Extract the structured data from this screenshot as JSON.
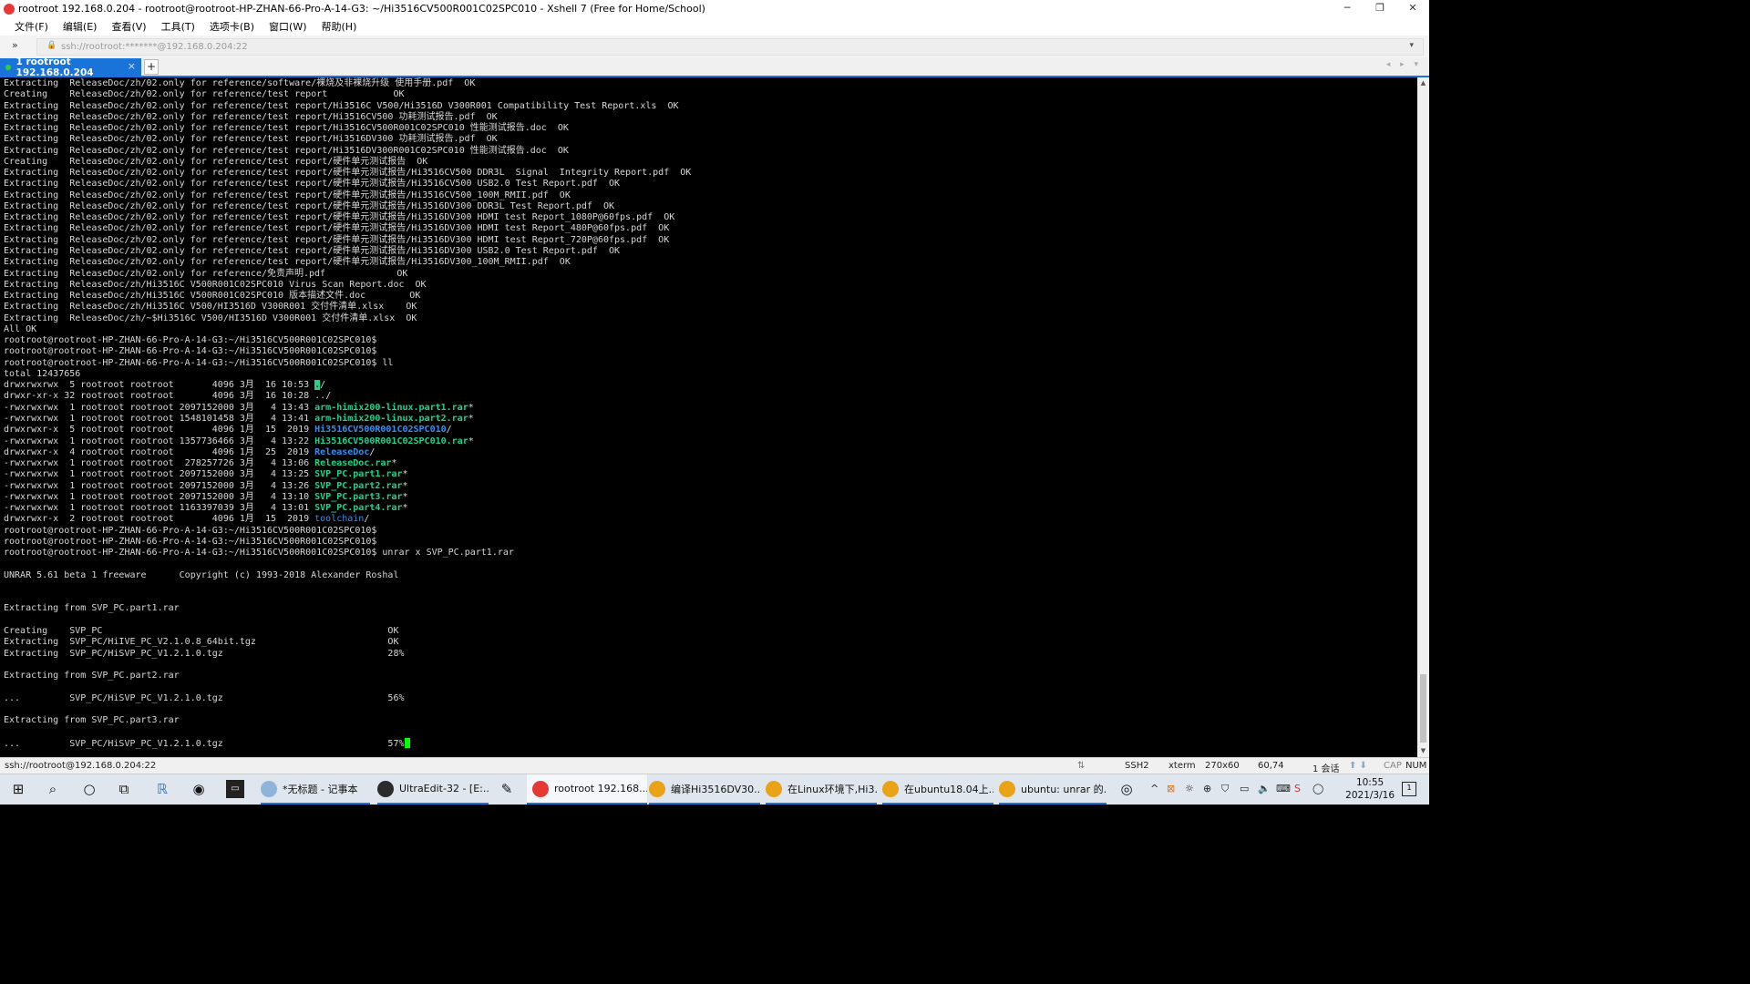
{
  "window": {
    "title": "rootroot 192.168.0.204 - rootroot@rootroot-HP-ZHAN-66-Pro-A-14-G3: ~/Hi3516CV500R001C02SPC010 - Xshell 7 (Free for Home/School)",
    "minimize": "─",
    "maximize": "❐",
    "close": "✕"
  },
  "menu": [
    "文件(F)",
    "编辑(E)",
    "查看(V)",
    "工具(T)",
    "选项卡(B)",
    "窗口(W)",
    "帮助(H)"
  ],
  "address": {
    "value": "ssh://rootroot:*******@192.168.0.204:22",
    "chevron": "»",
    "lock": "🔒",
    "dropdown": "▾"
  },
  "tabs": {
    "active_label": "1 rootroot 192.168.0.204",
    "close": "×",
    "add": "+",
    "nav": "◂ ▸ ▾"
  },
  "terminal": {
    "lines": [
      "Extracting  ReleaseDoc/zh/02.only for reference/software/裸烧及非裸烧升级 使用手册.pdf  OK",
      "Creating    ReleaseDoc/zh/02.only for reference/test report            OK",
      "Extracting  ReleaseDoc/zh/02.only for reference/test report/Hi3516C V500/Hi3516D V300R001 Compatibility Test Report.xls  OK",
      "Extracting  ReleaseDoc/zh/02.only for reference/test report/Hi3516CV500 功耗测试报告.pdf  OK",
      "Extracting  ReleaseDoc/zh/02.only for reference/test report/Hi3516CV500R001C02SPC010 性能测试报告.doc  OK",
      "Extracting  ReleaseDoc/zh/02.only for reference/test report/Hi3516DV300 功耗测试报告.pdf  OK",
      "Extracting  ReleaseDoc/zh/02.only for reference/test report/Hi3516DV300R001C02SPC010 性能测试报告.doc  OK",
      "Creating    ReleaseDoc/zh/02.only for reference/test report/硬件单元测试报告  OK",
      "Extracting  ReleaseDoc/zh/02.only for reference/test report/硬件单元测试报告/Hi3516CV500 DDR3L  Signal  Integrity Report.pdf  OK",
      "Extracting  ReleaseDoc/zh/02.only for reference/test report/硬件单元测试报告/Hi3516CV500 USB2.0 Test Report.pdf  OK",
      "Extracting  ReleaseDoc/zh/02.only for reference/test report/硬件单元测试报告/Hi3516CV500_100M_RMII.pdf  OK",
      "Extracting  ReleaseDoc/zh/02.only for reference/test report/硬件单元测试报告/Hi3516DV300 DDR3L Test Report.pdf  OK",
      "Extracting  ReleaseDoc/zh/02.only for reference/test report/硬件单元测试报告/Hi3516DV300 HDMI test Report_1080P@60fps.pdf  OK",
      "Extracting  ReleaseDoc/zh/02.only for reference/test report/硬件单元测试报告/Hi3516DV300 HDMI test Report_480P@60fps.pdf  OK",
      "Extracting  ReleaseDoc/zh/02.only for reference/test report/硬件单元测试报告/Hi3516DV300 HDMI test Report_720P@60fps.pdf  OK",
      "Extracting  ReleaseDoc/zh/02.only for reference/test report/硬件单元测试报告/Hi3516DV300 USB2.0 Test Report.pdf  OK",
      "Extracting  ReleaseDoc/zh/02.only for reference/test report/硬件单元测试报告/Hi3516DV300_100M_RMII.pdf  OK",
      "Extracting  ReleaseDoc/zh/02.only for reference/免责声明.pdf             OK",
      "Extracting  ReleaseDoc/zh/Hi3516C V500R001C02SPC010 Virus Scan Report.doc  OK",
      "Extracting  ReleaseDoc/zh/Hi3516C V500R001C02SPC010 版本描述文件.doc        OK",
      "Extracting  ReleaseDoc/zh/Hi3516C V500/HI3516D V300R001 交付件清单.xlsx    OK",
      "Extracting  ReleaseDoc/zh/~$Hi3516C V500/HI3516D V300R001 交付件清单.xlsx  OK",
      "All OK",
      "rootroot@rootroot-HP-ZHAN-66-Pro-A-14-G3:~/Hi3516CV500R001C02SPC010$",
      "rootroot@rootroot-HP-ZHAN-66-Pro-A-14-G3:~/Hi3516CV500R001C02SPC010$",
      "rootroot@rootroot-HP-ZHAN-66-Pro-A-14-G3:~/Hi3516CV500R001C02SPC010$ ll",
      "total 12437656"
    ],
    "listing": [
      {
        "prefix": "drwxrwxrwx  5 rootroot rootroot       4096 3月  16 10:53 ",
        "name": ".",
        "cls": "hl",
        "suffix": "/"
      },
      {
        "prefix": "drwxr-xr-x 32 rootroot rootroot       4096 3月  16 10:28 ",
        "name": "..",
        "cls": "",
        "suffix": "/"
      },
      {
        "prefix": "-rwxrwxrwx  1 rootroot rootroot 2097152000 3月   4 13:43 ",
        "name": "arm-himix200-linux.part1.rar",
        "cls": "x",
        "suffix": "*"
      },
      {
        "prefix": "-rwxrwxrwx  1 rootroot rootroot 1548101458 3月   4 13:41 ",
        "name": "arm-himix200-linux.part2.rar",
        "cls": "x",
        "suffix": "*"
      },
      {
        "prefix": "drwxrwxr-x  5 rootroot rootroot       4096 1月  15  2019 ",
        "name": "Hi3516CV500R001C02SPC010",
        "cls": "d",
        "suffix": "/"
      },
      {
        "prefix": "-rwxrwxrwx  1 rootroot rootroot 1357736466 3月   4 13:22 ",
        "name": "Hi3516CV500R001C02SPC010.rar",
        "cls": "x",
        "suffix": "*"
      },
      {
        "prefix": "drwxrwxr-x  4 rootroot rootroot       4096 1月  25  2019 ",
        "name": "ReleaseDoc",
        "cls": "d",
        "suffix": "/"
      },
      {
        "prefix": "-rwxrwxrwx  1 rootroot rootroot  278257726 3月   4 13:06 ",
        "name": "ReleaseDoc.rar",
        "cls": "x",
        "suffix": "*"
      },
      {
        "prefix": "-rwxrwxrwx  1 rootroot rootroot 2097152000 3月   4 13:25 ",
        "name": "SVP_PC.part1.rar",
        "cls": "x",
        "suffix": "*"
      },
      {
        "prefix": "-rwxrwxrwx  1 rootroot rootroot 2097152000 3月   4 13:26 ",
        "name": "SVP_PC.part2.rar",
        "cls": "x",
        "suffix": "*"
      },
      {
        "prefix": "-rwxrwxrwx  1 rootroot rootroot 2097152000 3月   4 13:10 ",
        "name": "SVP_PC.part3.rar",
        "cls": "x",
        "suffix": "*"
      },
      {
        "prefix": "-rwxrwxrwx  1 rootroot rootroot 1163397039 3月   4 13:01 ",
        "name": "SVP_PC.part4.rar",
        "cls": "x",
        "suffix": "*"
      },
      {
        "prefix": "drwxrwxr-x  2 rootroot rootroot       4096 1月  15  2019 ",
        "name": "toolchain",
        "cls": "t",
        "suffix": "/"
      }
    ],
    "tail": [
      "rootroot@rootroot-HP-ZHAN-66-Pro-A-14-G3:~/Hi3516CV500R001C02SPC010$",
      "rootroot@rootroot-HP-ZHAN-66-Pro-A-14-G3:~/Hi3516CV500R001C02SPC010$",
      "rootroot@rootroot-HP-ZHAN-66-Pro-A-14-G3:~/Hi3516CV500R001C02SPC010$ unrar x SVP_PC.part1.rar",
      "",
      "UNRAR 5.61 beta 1 freeware      Copyright (c) 1993-2018 Alexander Roshal",
      "",
      "",
      "Extracting from SVP_PC.part1.rar",
      "",
      "Creating    SVP_PC                                                    OK",
      "Extracting  SVP_PC/HiIVE_PC_V2.1.0.8_64bit.tgz                        OK",
      "Extracting  SVP_PC/HiSVP_PC_V1.2.1.0.tgz                              28%",
      "",
      "Extracting from SVP_PC.part2.rar",
      "",
      "...         SVP_PC/HiSVP_PC_V1.2.1.0.tgz                              56%",
      "",
      "Extracting from SVP_PC.part3.rar",
      ""
    ],
    "last_line": "...         SVP_PC/HiSVP_PC_V1.2.1.0.tgz                              57%"
  },
  "status": {
    "connection": "ssh://rootroot@192.168.0.204:22",
    "protocol": "SSH2",
    "term": "xterm",
    "size": "270x60",
    "cursor": "60,74",
    "sessions": "1 会话",
    "caps": "CAP",
    "num": "NUM"
  },
  "taskbar": {
    "apps": [
      {
        "label": "*无标题 - 记事本",
        "color": "#8fb4d9",
        "state": "open"
      },
      {
        "label": "UltraEdit-32 - [E:...",
        "color": "#2b2b2b",
        "state": "open"
      },
      {
        "label": "rootroot 192.168...",
        "color": "#e53935",
        "state": "active"
      },
      {
        "label": "编译Hi3516DV30...",
        "color": "#e8a317",
        "state": "open"
      },
      {
        "label": "在Linux环境下,Hi3...",
        "color": "#e8a317",
        "state": "open"
      },
      {
        "label": "在ubuntu18.04上...",
        "color": "#e8a317",
        "state": "open"
      },
      {
        "label": "ubuntu: unrar 的...",
        "color": "#e8a317",
        "state": "open"
      }
    ],
    "clock_time": "10:55",
    "clock_date": "2021/3/16",
    "notify_count": "1"
  }
}
